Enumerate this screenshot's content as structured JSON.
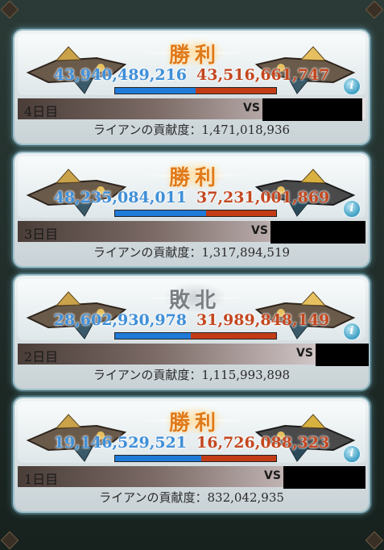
{
  "icons": {
    "info": "i",
    "ally_ship": "airship-icon",
    "enemy_ship": "airship-icon"
  },
  "colors": {
    "ally": "#3f8fd8",
    "enemy": "#c4471f",
    "win": "#e07a1a",
    "lose": "#7a7f82"
  },
  "battles": [
    {
      "result": "勝利",
      "result_type": "win",
      "ally_score": "43,940,489,216",
      "enemy_score": "43,516,661,747",
      "ally_ratio": 0.502,
      "day": "4日目",
      "vs": "VS",
      "contribution": "ライアンの貢献度：1,471,018,936"
    },
    {
      "result": "勝利",
      "result_type": "win",
      "ally_score": "48,235,084,011",
      "enemy_score": "37,231,001,869",
      "ally_ratio": 0.564,
      "day": "3日目",
      "vs": "VS",
      "contribution": "ライアンの貢献度：1,317,894,519"
    },
    {
      "result": "敗北",
      "result_type": "lose",
      "ally_score": "28,602,930,978",
      "enemy_score": "31,989,848,149",
      "ally_ratio": 0.472,
      "day": "2日目",
      "vs": "VS",
      "contribution": "ライアンの貢献度：1,115,993,898"
    },
    {
      "result": "勝利",
      "result_type": "win",
      "ally_score": "19,146,529,521",
      "enemy_score": "16,726,088,323",
      "ally_ratio": 0.534,
      "day": "1日目",
      "vs": "VS",
      "contribution": "ライアンの貢献度：832,042,935"
    }
  ]
}
